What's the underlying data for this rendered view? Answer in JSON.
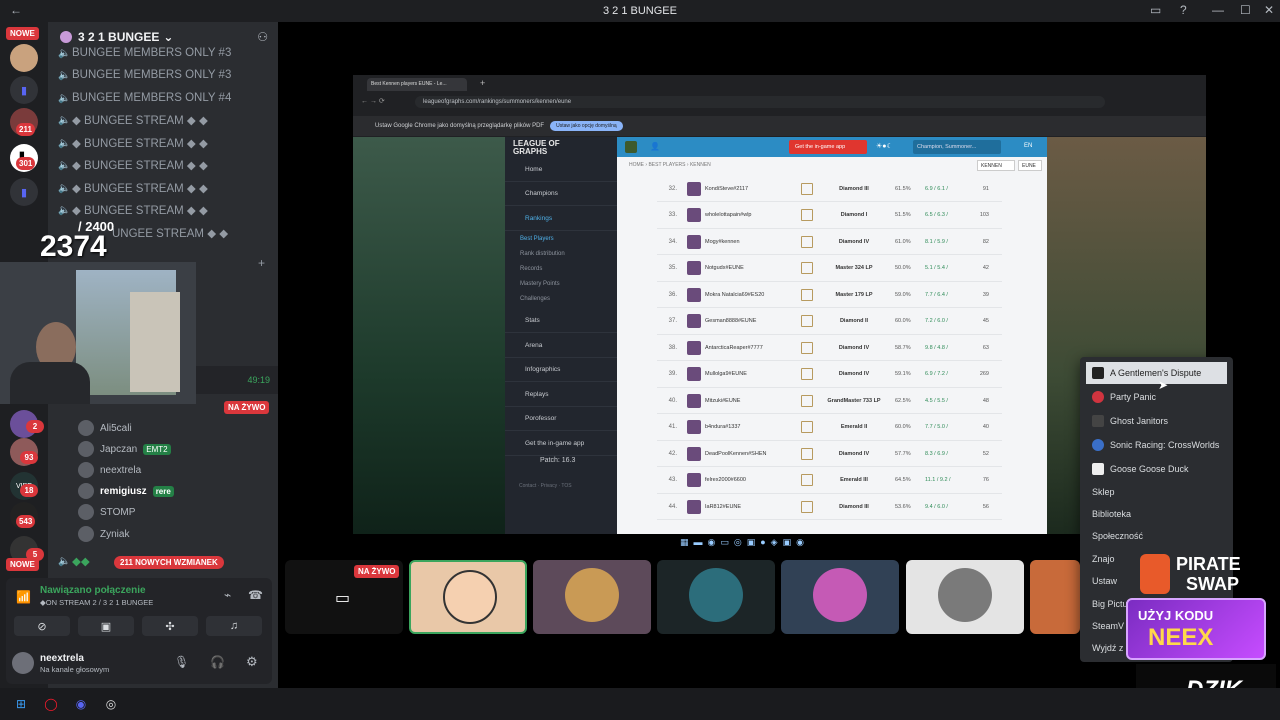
{
  "titlebar": {
    "title": "3 2 1 BUNGEE",
    "back": "←",
    "min": "—",
    "max": "☐",
    "close": "✕"
  },
  "rail": {
    "nowe_top": "NOWE",
    "badges": [
      "211",
      "301",
      "2",
      "93",
      "18",
      "543",
      "5"
    ],
    "nowe_bottom": "NOWE"
  },
  "server": {
    "name": "3 2 1 BUNGEE",
    "chevron": "⌄"
  },
  "channels": [
    "BUNGEE MEMBERS ONLY #3",
    "BUNGEE MEMBERS ONLY #3",
    "BUNGEE MEMBERS ONLY #4",
    "◆ BUNGEE STREAM ◆ ◆",
    "◆ BUNGEE STREAM ◆ ◆",
    "◆ BUNGEE STREAM ◆ ◆",
    "◆ BUNGEE STREAM ◆ ◆",
    "◆ BUNGEE STREAM ◆ ◆",
    "UNGEE STREAM ◆ ◆"
  ],
  "counter": {
    "value": "2374",
    "total": "/ 2400"
  },
  "cam": {
    "timer": "49:19",
    "live": "NA ŻYWO"
  },
  "voice_users": [
    {
      "name": "Ali5cali",
      "tag": ""
    },
    {
      "name": "Japczan",
      "tag": "EMT2"
    },
    {
      "name": "neextrela",
      "tag": ""
    },
    {
      "name": "remigiusz",
      "tag": "rere"
    },
    {
      "name": "STOMP",
      "tag": ""
    },
    {
      "name": "Zyniak",
      "tag": ""
    }
  ],
  "mentions": "211 NOWYCH WZMIANEK",
  "voice_panel": {
    "status": "Nawiązano połączenie",
    "channel": "◆ON STREAM 2 / 3 2 1 BUNGEE"
  },
  "user": {
    "name": "neextrela",
    "status": "Na kanale głosowym"
  },
  "browser": {
    "tab": "Best Kennen players EUNE - Le...",
    "url": "leagueofgraphs.com/rankings/summoners/kennen/eune",
    "infobar": "Ustaw Google Chrome jako domyślną przeglądarkę plików PDF",
    "infobar_btn": "Ustaw jako opcję domyślną"
  },
  "log": {
    "logo": "LEAGUE OF GRAPHS",
    "get_app": "Get the in-game app",
    "search": "Champion, Summoner...",
    "lang": "EN",
    "breadcrumb": "HOME › BEST PLAYERS › KENNEN",
    "region": "EUNE",
    "champ": "KENNEN",
    "nav": [
      "Home",
      "Champions",
      "Rankings",
      "Stats",
      "Arena",
      "Infographics",
      "Replays",
      "Porofessor",
      "Get the in-game app"
    ],
    "subnav": [
      "Best Players",
      "Rank distribution",
      "Records",
      "Mastery Points",
      "Challenges"
    ],
    "patch": "Patch: 16.3",
    "footer": "Contact · Privacy · TOS",
    "rows": [
      {
        "rank": "32.",
        "name": "KondiSteve#2117",
        "tier": "Diamond III",
        "wr": "61.5%",
        "kda": "6.9 / 6.1 /",
        "games": "91"
      },
      {
        "rank": "33.",
        "name": "wholelottapain#wlp",
        "tier": "Diamond I",
        "wr": "51.5%",
        "kda": "6.5 / 6.3 /",
        "games": "103"
      },
      {
        "rank": "34.",
        "name": "Mogy#kennen",
        "tier": "Diamond IV",
        "wr": "61.0%",
        "kda": "8.1 / 5.9 /",
        "games": "82"
      },
      {
        "rank": "35.",
        "name": "Notgudx#EUNE",
        "tier": "Master 324 LP",
        "wr": "50.0%",
        "kda": "5.1 / 5.4 /",
        "games": "42"
      },
      {
        "rank": "36.",
        "name": "Mokra Natalcia69#ES20",
        "tier": "Master 179 LP",
        "wr": "59.0%",
        "kda": "7.7 / 6.4 /",
        "games": "39"
      },
      {
        "rank": "37.",
        "name": "Gesman8888#EUNE",
        "tier": "Diamond II",
        "wr": "60.0%",
        "kda": "7.2 / 6.0 /",
        "games": "45"
      },
      {
        "rank": "38.",
        "name": "AntarcticaReaper#7777",
        "tier": "Diamond IV",
        "wr": "58.7%",
        "kda": "9.8 / 4.8 /",
        "games": "63"
      },
      {
        "rank": "39.",
        "name": "Mullolga9#EUNE",
        "tier": "Diamond IV",
        "wr": "59.1%",
        "kda": "6.9 / 7.2 /",
        "games": "269"
      },
      {
        "rank": "40.",
        "name": "Mitzuki#EUNE",
        "tier": "GrandMaster 733 LP",
        "wr": "62.5%",
        "kda": "4.5 / 5.5 /",
        "games": "48"
      },
      {
        "rank": "41.",
        "name": "b4ndura#1337",
        "tier": "Emerald II",
        "wr": "60.0%",
        "kda": "7.7 / 5.0 /",
        "games": "40"
      },
      {
        "rank": "42.",
        "name": "DeadPoolKennen#SHEN",
        "tier": "Diamond IV",
        "wr": "57.7%",
        "kda": "8.3 / 6.9 /",
        "games": "52"
      },
      {
        "rank": "43.",
        "name": "felrex2000#6600",
        "tier": "Emerald III",
        "wr": "64.5%",
        "kda": "11.1 / 9.2 /",
        "games": "76"
      },
      {
        "rank": "44.",
        "name": "IaR812#EUNE",
        "tier": "Diamond III",
        "wr": "53.6%",
        "kda": "9.4 / 6.0 /",
        "games": "56"
      }
    ]
  },
  "tiles": {
    "live": "NA ŻYWO"
  },
  "context_menu": {
    "games": [
      "A Gentlemen's Dispute",
      "Party Panic",
      "Ghost Janitors",
      "Sonic Racing: CrossWorlds",
      "Goose Goose Duck"
    ],
    "items": [
      "Sklep",
      "Biblioteka",
      "Społeczność",
      "Znajo",
      "Ustaw",
      "Big Pictu",
      "SteamV",
      "Wyjdź z"
    ]
  },
  "sponsors": {
    "pirate1": "PIRATE",
    "pirate2": "SWAP",
    "neex1": "UŻYJ KODU",
    "neex2": "NEEX",
    "dzik": "DZIK"
  },
  "colors": {
    "discord_bg": "#2b2d31",
    "log_blue": "#2c8cc4",
    "live_red": "#da373c",
    "green": "#3ba55d"
  }
}
